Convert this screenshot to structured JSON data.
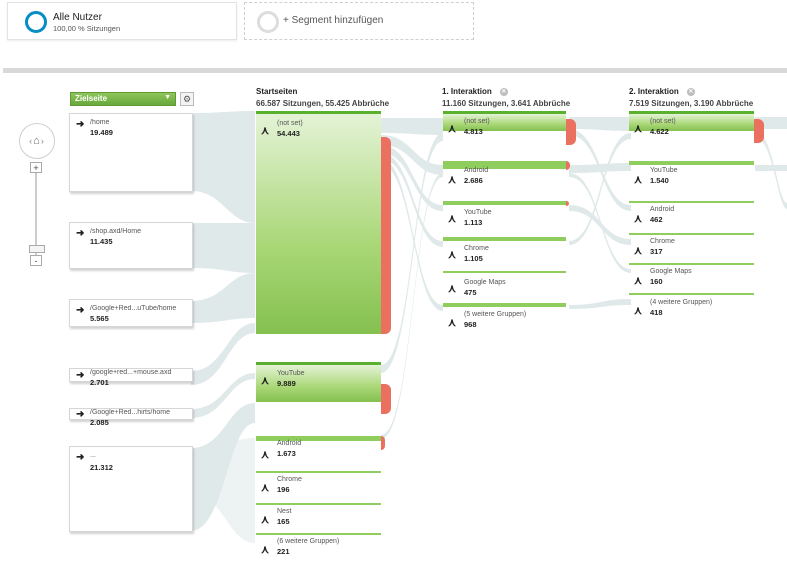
{
  "segments": {
    "all_users": {
      "title": "Alle Nutzer",
      "subtitle": "100,00 % Sitzungen"
    },
    "add_segment": {
      "label": "+ Segment hinzufügen"
    }
  },
  "zoom": {
    "plus": "+",
    "minus": "-"
  },
  "dimension_select": {
    "label": "Zielseite"
  },
  "columns": {
    "start": {
      "title": "Startseiten",
      "sub": "66.587 Sitzungen, 55.425 Abbrüche"
    },
    "i1": {
      "title": "1. Interaktion",
      "sub": "11.160 Sitzungen, 3.641 Abbrüche"
    },
    "i2": {
      "title": "2. Interaktion",
      "sub": "7.519 Sitzungen, 3.190 Abbrüche"
    }
  },
  "landing_pages": [
    {
      "label": "/home",
      "value": "19.489"
    },
    {
      "label": "/shop.axd/Home",
      "value": "11.435"
    },
    {
      "label": "/Google+Red...uTube/home",
      "value": "5.565"
    },
    {
      "label": "/google+red...+mouse.axd",
      "value": "2.701"
    },
    {
      "label": "/Google+Red...hirts/home",
      "value": "2.085"
    },
    {
      "label": "...",
      "value": "21.312"
    }
  ],
  "start_nodes": [
    {
      "label": "(not set)",
      "value": "54.443"
    },
    {
      "label": "YouTube",
      "value": "9.889"
    },
    {
      "label": "Android",
      "value": "1.673"
    },
    {
      "label": "Chrome",
      "value": "196"
    },
    {
      "label": "Nest",
      "value": "165"
    },
    {
      "label": "(6 weitere Gruppen)",
      "value": "221"
    }
  ],
  "i1_nodes": [
    {
      "label": "(not set)",
      "value": "4.813"
    },
    {
      "label": "Android",
      "value": "2.686"
    },
    {
      "label": "YouTube",
      "value": "1.113"
    },
    {
      "label": "Chrome",
      "value": "1.105"
    },
    {
      "label": "Google Maps",
      "value": "475"
    },
    {
      "label": "(5 weitere Gruppen)",
      "value": "968"
    }
  ],
  "i2_nodes": [
    {
      "label": "(not set)",
      "value": "4.622"
    },
    {
      "label": "YouTube",
      "value": "1.540"
    },
    {
      "label": "Android",
      "value": "462"
    },
    {
      "label": "Chrome",
      "value": "317"
    },
    {
      "label": "Google Maps",
      "value": "160"
    },
    {
      "label": "(4 weitere Gruppen)",
      "value": "418"
    }
  ],
  "colors": {
    "node_green": "#84c050",
    "drop_red": "#ea7060",
    "flow": "#d8e3e3",
    "accent_blue": "#058dc7"
  }
}
